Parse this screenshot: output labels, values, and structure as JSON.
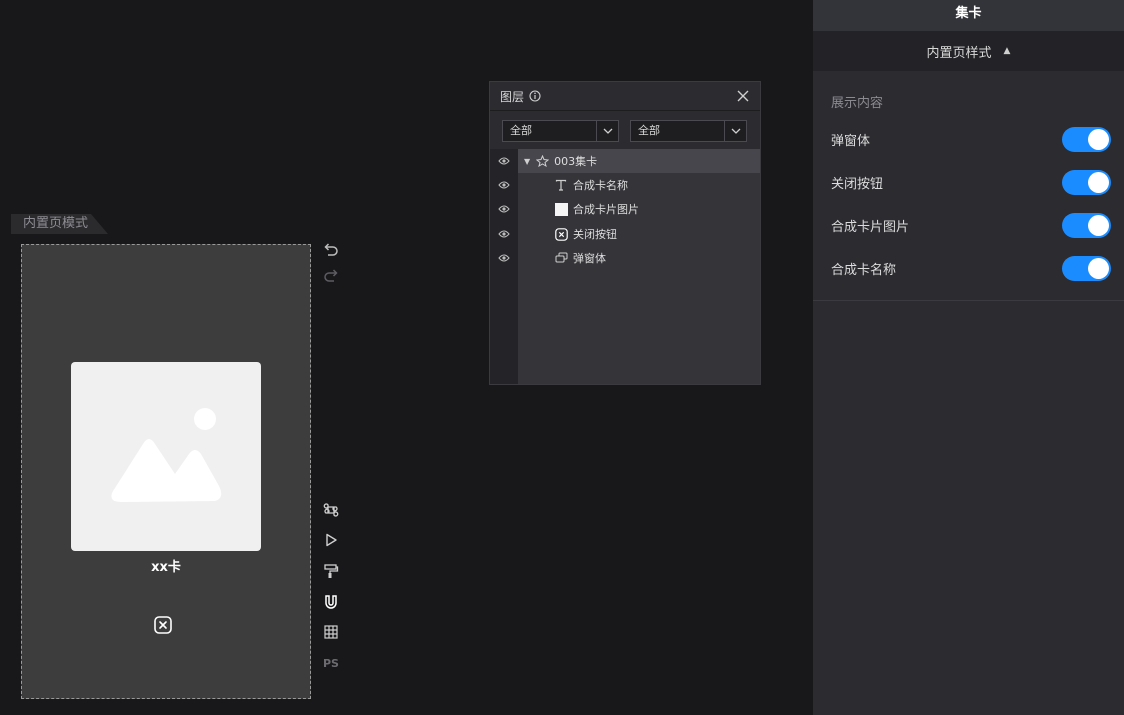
{
  "canvas": {
    "artboard_tab": "内置页模式",
    "card_name": "xx卡",
    "icons": [
      "image-placeholder-icon",
      "close-box-icon"
    ]
  },
  "toolbar": {
    "top": [
      "undo-icon",
      "redo-icon"
    ],
    "bottom": [
      "command-icon",
      "play-icon",
      "paint-roller-icon",
      "magnet-icon",
      "grid-icon",
      "ps-icon"
    ],
    "ps_label": "PS"
  },
  "layers_panel": {
    "title": "图层",
    "filter1": "全部",
    "filter2": "全部",
    "items": [
      {
        "label": "003集卡",
        "icon": "component-icon",
        "expanded": true,
        "active": true
      },
      {
        "label": "合成卡名称",
        "icon": "text-icon"
      },
      {
        "label": "合成卡片图片",
        "icon": "image-icon"
      },
      {
        "label": "关闭按钮",
        "icon": "close-box-icon"
      },
      {
        "label": "弹窗体",
        "icon": "layers-icon"
      }
    ]
  },
  "right_panel": {
    "title": "集卡",
    "section": "内置页样式",
    "group_label": "展示内容",
    "toggles": [
      {
        "label": "弹窗体",
        "on": true
      },
      {
        "label": "关闭按钮",
        "on": true
      },
      {
        "label": "合成卡片图片",
        "on": true
      },
      {
        "label": "合成卡名称",
        "on": true
      }
    ]
  },
  "colors": {
    "accent": "#1a8cff",
    "background": "#18181b",
    "panel": "#2b2b30",
    "artboard": "#3d3d3d"
  }
}
